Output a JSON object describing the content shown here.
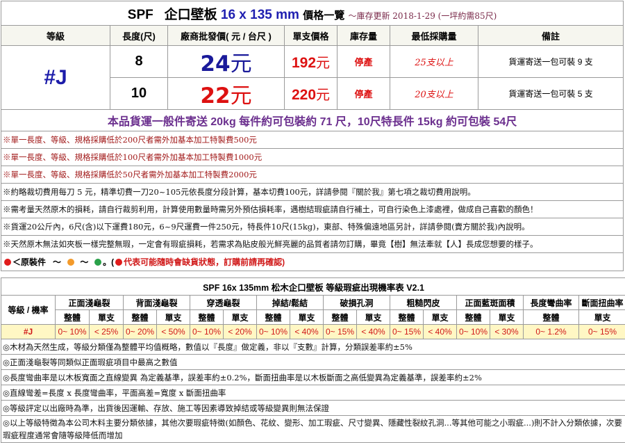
{
  "title": {
    "prefix": "SPF",
    "name": "企口壁板",
    "size": "16 x 135 mm",
    "suffix": "價格一覽",
    "note": "～庫存更新 2018-1-29 (一坪約需85尺)"
  },
  "headers": {
    "grade": "等級",
    "length": "長度(尺)",
    "price": "廠商批發價( 元 / 台尺 )",
    "unit_price": "單支價格",
    "stock": "庫存量",
    "min_buy": "最低採購量",
    "remark": "備註"
  },
  "grade_value": "#J",
  "rows": [
    {
      "length": "8",
      "price_num": "24",
      "price_unit": "元",
      "unit_num": "192",
      "unit_unit": "元",
      "stock": "停產",
      "min_buy": "25支以上",
      "remark": "貨運寄送一包可裝 9 支"
    },
    {
      "length": "10",
      "price_num": "22",
      "price_unit": "元",
      "unit_num": "220",
      "unit_unit": "元",
      "stock": "停產",
      "min_buy": "20支以上",
      "remark": "貨運寄送一包可裝 5 支"
    }
  ],
  "shipping": "本品貨運一般件寄送 20kg 每件約可包裝約 71 尺，10尺特長件 15kg 約可包裝 54尺",
  "notes": [
    "※單一長度、等級、規格採購低於200尺者需外加基本加工特製費500元",
    "※單一長度、等級、規格採購低於100尺者需外加基本加工特製費1000元",
    "※單一長度、等級、規格採購低於50尺者需外加基本加工特製費2000元",
    "※約略裁切費用每刀 5 元，精準切費一刀20~105元依長度分段計算，基本切費100元，詳請參閱『關於我』第七項之裁切費用說明。",
    "※需考量天然原木的損耗，請自行裁剪利用，計算使用數量時需另外預估損耗率，遇樹結瑕疵請自行補土，可自行染色上漆處裡，做成自己喜歡的顏色！",
    "※貨運20公斤內，6尺(含)以下運費180元，6~9尺運費一件250元，特長件10尺(15kg)，東部、特殊偏遠地區另計，詳請參閱(賣方關於我)內說明。",
    "※天然原木無法如夾板一樣完整無瑕，一定會有瑕疵損耗，若需求為貼皮般光鮮亮麗的品質者請勿訂購，畢竟【樹】無法牽就【人】長成您想要的樣子。"
  ],
  "legend": {
    "label": "＜原裝件",
    "tilde": "～",
    "end": "。(",
    "warning": "代表可能隨時會缺貨狀態，訂購前請再確認)"
  },
  "legend_colors": {
    "red": "#e01b1b",
    "orange": "#f39a2b",
    "green": "#2aa14a"
  },
  "defect_table": {
    "title": "SPF 16x 135mm 松木企口壁板 等級瑕疵出現機率表 V2.1",
    "corner": "等級 / 機率",
    "groups": [
      "正面淺龜裂",
      "背面淺龜裂",
      "穿透龜裂",
      "掉結/鬆結",
      "破損孔洞",
      "粗糙閃皮",
      "正面藍斑面積",
      "長度彎曲率",
      "斷面扭曲率"
    ],
    "sub": {
      "whole": "整體",
      "single": "單支"
    },
    "row": {
      "grade": "#J",
      "cells": [
        "0~ 10%",
        "< 25%",
        "0~ 20%",
        "< 50%",
        "0~ 10%",
        "< 20%",
        "0~ 10%",
        "< 40%",
        "0~ 15%",
        "< 40%",
        "0~ 15%",
        "< 40%",
        "0~ 10%",
        "< 30%",
        "0~ 1.2%",
        "0~ 15%"
      ]
    },
    "footnotes": [
      "◎木材為天然生成，等級分類僅為整體平均值概略，數值以『長度』做定義，非以『支數』計算，分類誤差率約±5%",
      "◎正面淺龜裂等同類似正面瑕疵項目中最高之數值",
      "◎長度彎曲率是以木板寬面之直線變異 為定義基準，誤差率約±0.2%，斷面扭曲率是以木板斷面之高低變異為定義基準，誤差率約±2%",
      "◎直線彎差=長度 x 長度彎曲率，平面高差=寬度 x 斷面扭曲率",
      "◎等級評定以出廠時為準，出貨後因運輸、存放、施工等因素導致掉結或等級變異則無法保證",
      "◎以上等級特徵為本公司木料主要分類依據，其他次要瑕疵特徵(如顏色、花紋、變形、加工瑕疵、尺寸變異、隱藏性裂紋孔洞...等其他可能之小瑕疵...)則不計入分類依據，次要瑕疵程度通常會隨等級降低而增加"
    ]
  }
}
